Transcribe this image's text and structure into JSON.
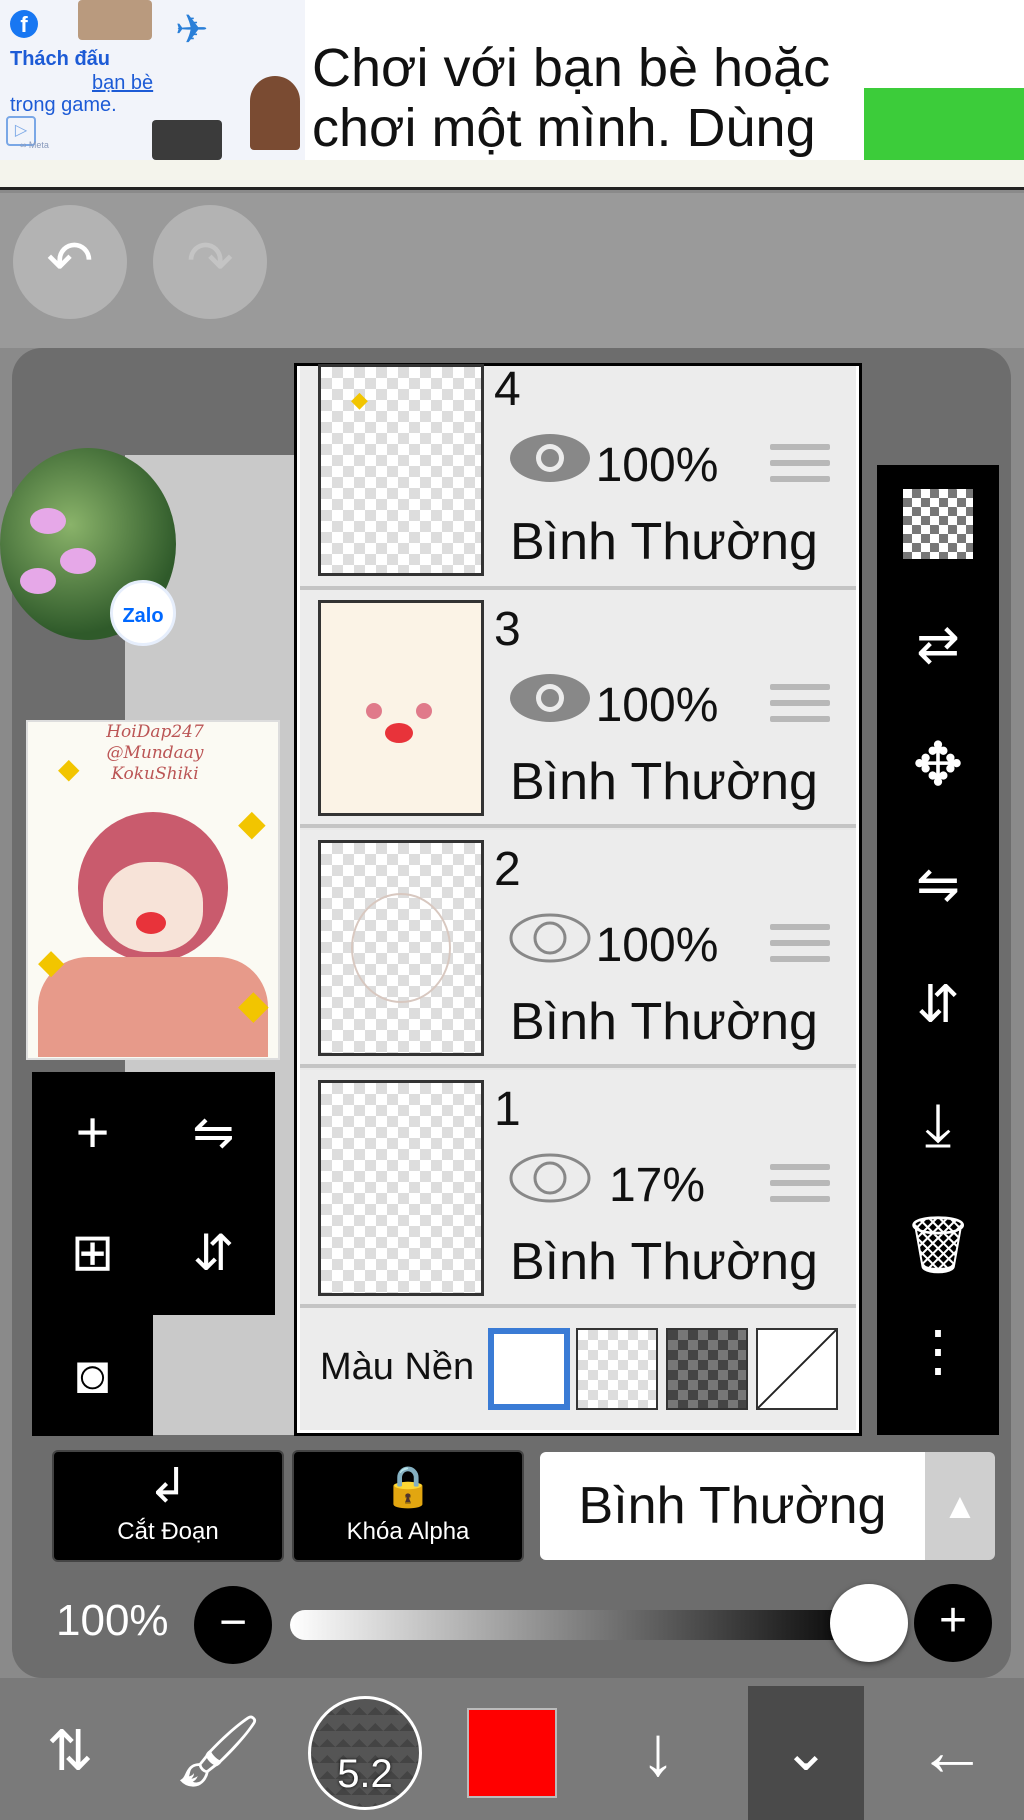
{
  "ad": {
    "brand_icon": "facebook-icon",
    "text_line1": "Thách đấu",
    "text_line2": "bạn bè",
    "text_line3": "trong game.",
    "meta_label": "∞ Meta",
    "headline": "Chơi với bạn bè hoặc chơi một mình. Dùng"
  },
  "history": {
    "undo_icon": "undo-icon",
    "redo_icon": "redo-icon"
  },
  "preview": {
    "signature": "HoiDap247 @Mundaay KokuShiki"
  },
  "zalo": {
    "label": "Zalo"
  },
  "layers": [
    {
      "number": "4",
      "opacity": "100%",
      "blend": "Bình Thường",
      "visible": true
    },
    {
      "number": "3",
      "opacity": "100%",
      "blend": "Bình Thường",
      "visible": true
    },
    {
      "number": "2",
      "opacity": "100%",
      "blend": "Bình Thường",
      "visible": false
    },
    {
      "number": "1",
      "opacity": "17%",
      "blend": "Bình Thường",
      "visible": false
    }
  ],
  "background": {
    "label": "Màu Nền",
    "selected": 0
  },
  "mode": {
    "clip_label": "Cắt Đoạn",
    "alpha_label": "Khóa Alpha",
    "blend_value": "Bình Thường"
  },
  "opacity": {
    "label": "100%",
    "value": 1.0
  },
  "brush": {
    "size": "5.2",
    "color": "#ff0000"
  },
  "colors": {
    "accent_select": "#3a7bd5",
    "ad_cta": "#3ccc3a"
  }
}
